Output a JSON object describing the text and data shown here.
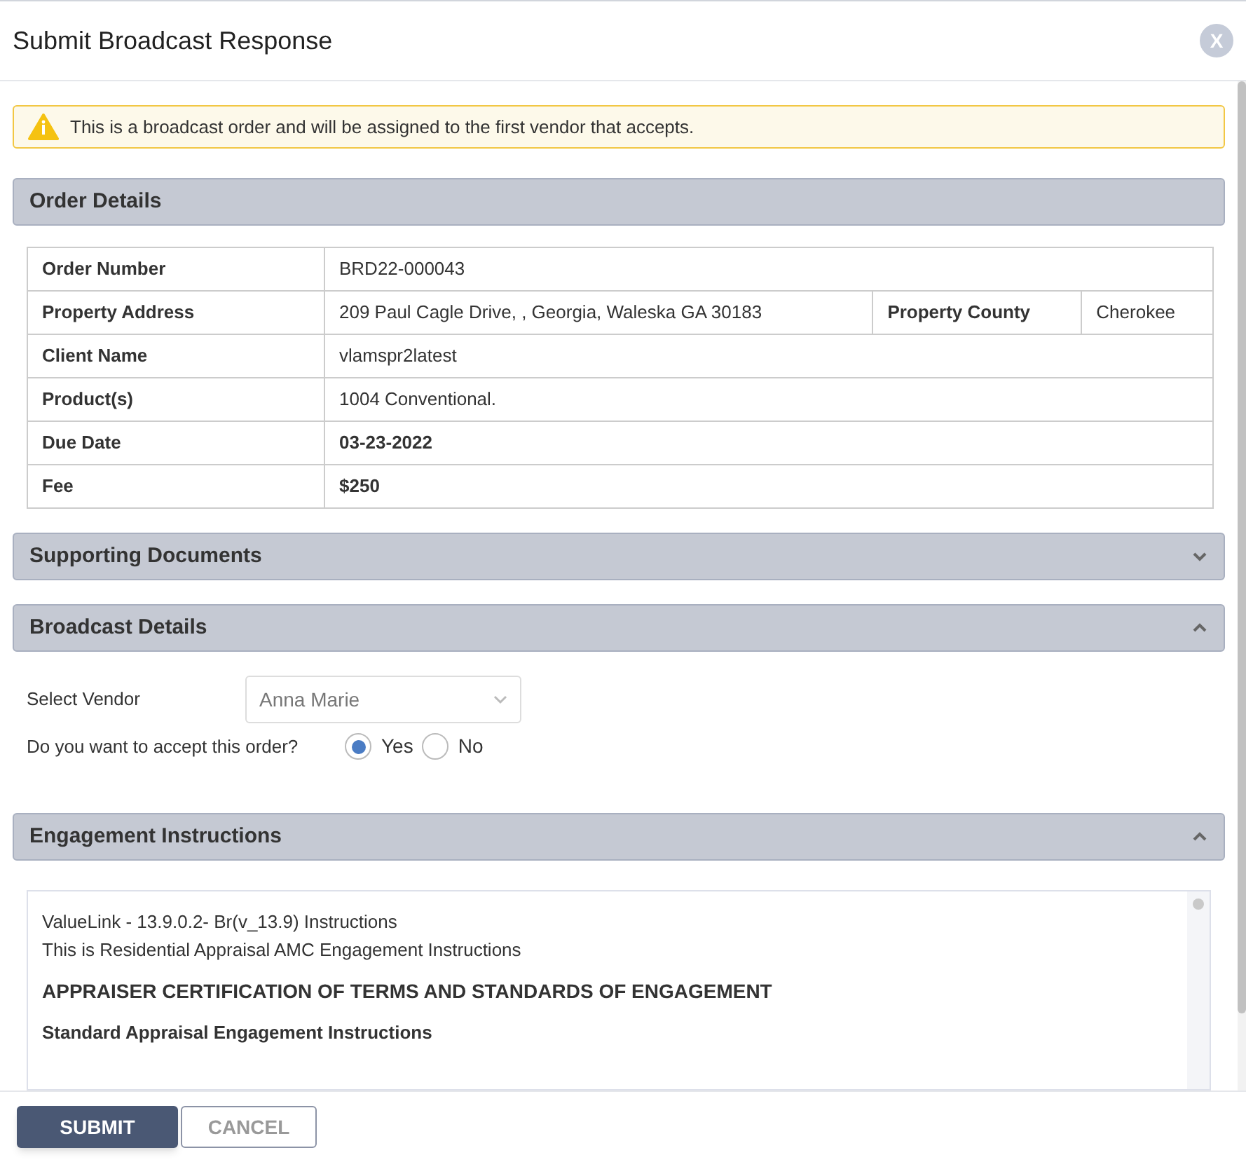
{
  "window": {
    "title": "Submit Broadcast Response",
    "close_label": "X"
  },
  "alert": {
    "text": "This is a broadcast order and will be assigned to the first vendor that accepts."
  },
  "sections": [
    {
      "kind": "details",
      "title": "Order Details",
      "rows": [
        {
          "label": "Order Number",
          "value": "BRD22-000043",
          "kind": "plain"
        },
        {
          "label": "Property Address",
          "value": "209 Paul Cagle Drive, , Georgia, Waleska GA 30183",
          "kind": "split",
          "extra_label": "Property County",
          "extra_value": "Cherokee"
        },
        {
          "label": "Client Name",
          "value": "vlamspr2latest",
          "kind": "plain"
        },
        {
          "label": "Product(s)",
          "value": "1004 Conventional.",
          "kind": "plain"
        },
        {
          "label": "Due Date",
          "value": "03-23-2022",
          "kind": "emphasis"
        },
        {
          "label": "Fee",
          "value": "$250",
          "kind": "emphasis"
        }
      ]
    },
    {
      "kind": "documents",
      "title": "Supporting Documents",
      "expanded": false
    },
    {
      "kind": "broadcast",
      "title": "Broadcast Details",
      "expanded": true,
      "vendor_label": "Select Vendor",
      "vendor_value": "Anna Marie",
      "accept_label": "Do you want to accept this order?",
      "options": [
        {
          "label": "Yes",
          "selected": true
        },
        {
          "label": "No",
          "selected": false
        }
      ]
    },
    {
      "kind": "instructions",
      "title": "Engagement Instructions",
      "expanded": true,
      "lines": [
        {
          "kind": "plain",
          "text": "ValueLink - 13.9.0.2- Br(v_13.9) Instructions"
        },
        {
          "kind": "plain",
          "text": "This is Residential Appraisal AMC Engagement Instructions"
        },
        {
          "kind": "heading",
          "text": "APPRAISER CERTIFICATION OF TERMS AND STANDARDS OF ENGAGEMENT"
        },
        {
          "kind": "subheading",
          "text": "Standard Appraisal Engagement Instructions"
        }
      ]
    }
  ],
  "buttons": [
    {
      "label": "SUBMIT",
      "kind": "primary"
    },
    {
      "label": "CANCEL",
      "kind": "secondary"
    }
  ]
}
